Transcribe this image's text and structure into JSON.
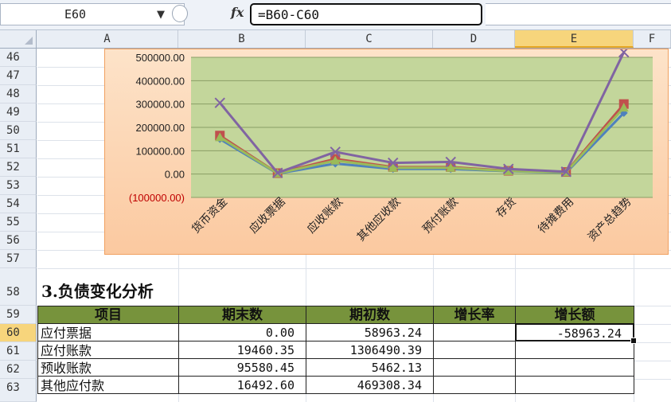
{
  "formula_bar": {
    "name_box": "E60",
    "fx_label": "fx",
    "formula": "=B60-C60"
  },
  "columns": [
    "A",
    "B",
    "C",
    "D",
    "E",
    "F"
  ],
  "active_column": "E",
  "rows": [
    "46",
    "47",
    "48",
    "49",
    "50",
    "51",
    "52",
    "53",
    "54",
    "55",
    "56",
    "57",
    "58",
    "59",
    "60",
    "61",
    "62",
    "63"
  ],
  "active_row": "60",
  "colors": {
    "plot_area": "#c3d69b",
    "chart_bg": "#fcd5b4",
    "header_fill": "#77933c",
    "negative_label": "#c00000",
    "series_blue": "#4f81bd",
    "series_red": "#c0504d",
    "series_green": "#9bbb59",
    "series_purple": "#8064a2"
  },
  "chart_data": {
    "type": "line",
    "categories": [
      "货币资金",
      "应收票据",
      "应收账款",
      "其他应收款",
      "预付账款",
      "存货",
      "待摊费用",
      "资产总趋势"
    ],
    "ylim": [
      -100000,
      500000
    ],
    "y_ticks": [
      "500000.00",
      "400000.00",
      "300000.00",
      "200000.00",
      "100000.00",
      "0.00",
      "(100000.00)"
    ],
    "y_tick_values": [
      500000,
      400000,
      300000,
      200000,
      100000,
      0,
      -100000
    ],
    "grid": true,
    "series": [
      {
        "color": "#4f81bd",
        "marker": "diamond",
        "values": [
          150000,
          2000,
          45000,
          22000,
          22000,
          12000,
          6000,
          262000
        ]
      },
      {
        "color": "#c0504d",
        "marker": "square",
        "values": [
          165000,
          4000,
          65000,
          30000,
          30000,
          14000,
          9000,
          300000
        ]
      },
      {
        "color": "#9bbb59",
        "marker": "triangle",
        "values": [
          158000,
          3000,
          58000,
          27000,
          27000,
          13000,
          8000,
          285000
        ]
      },
      {
        "color": "#8064a2",
        "marker": "x",
        "values": [
          305000,
          5000,
          95000,
          48000,
          52000,
          22000,
          10000,
          522000
        ]
      }
    ]
  },
  "section_title": "3.负债变化分析",
  "table": {
    "headers": [
      "项目",
      "期末数",
      "期初数",
      "增长率",
      "增长额"
    ],
    "rows": [
      {
        "item": "应付票据",
        "end": "0.00",
        "begin": "58963.24",
        "rate": "",
        "amount": "-58963.24"
      },
      {
        "item": "应付账款",
        "end": "19460.35",
        "begin": "1306490.39",
        "rate": "",
        "amount": ""
      },
      {
        "item": "预收账款",
        "end": "95580.45",
        "begin": "5462.13",
        "rate": "",
        "amount": ""
      },
      {
        "item": "其他应付款",
        "end": "16492.60",
        "begin": "469308.34",
        "rate": "",
        "amount": ""
      }
    ]
  }
}
